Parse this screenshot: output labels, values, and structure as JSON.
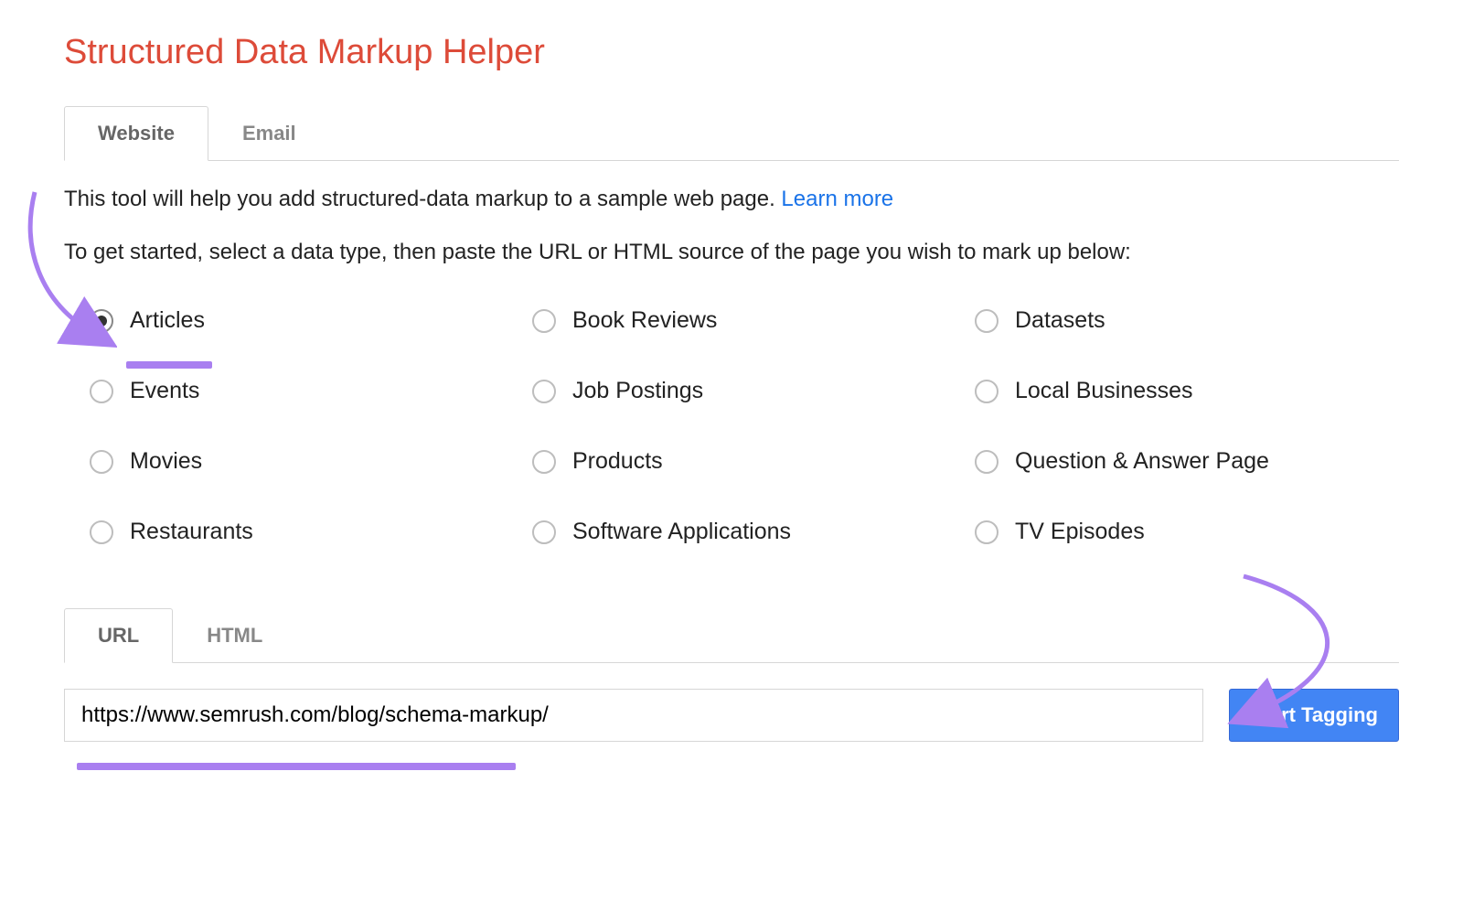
{
  "header": {
    "title": "Structured Data Markup Helper"
  },
  "main_tabs": {
    "items": [
      {
        "label": "Website",
        "active": true
      },
      {
        "label": "Email",
        "active": false
      }
    ]
  },
  "intro": {
    "text_before_link": "This tool will help you add structured-data markup to a sample web page. ",
    "link_text": "Learn more",
    "subline": "To get started, select a data type, then paste the URL or HTML source of the page you wish to mark up below:"
  },
  "data_types": {
    "options": [
      {
        "id": "articles",
        "label": "Articles",
        "selected": true
      },
      {
        "id": "book-reviews",
        "label": "Book Reviews",
        "selected": false
      },
      {
        "id": "datasets",
        "label": "Datasets",
        "selected": false
      },
      {
        "id": "events",
        "label": "Events",
        "selected": false
      },
      {
        "id": "job-postings",
        "label": "Job Postings",
        "selected": false
      },
      {
        "id": "local-businesses",
        "label": "Local Businesses",
        "selected": false
      },
      {
        "id": "movies",
        "label": "Movies",
        "selected": false
      },
      {
        "id": "products",
        "label": "Products",
        "selected": false
      },
      {
        "id": "qa-page",
        "label": "Question & Answer Page",
        "selected": false
      },
      {
        "id": "restaurants",
        "label": "Restaurants",
        "selected": false
      },
      {
        "id": "software-apps",
        "label": "Software Applications",
        "selected": false
      },
      {
        "id": "tv-episodes",
        "label": "TV Episodes",
        "selected": false
      }
    ]
  },
  "source_tabs": {
    "items": [
      {
        "label": "URL",
        "active": true
      },
      {
        "label": "HTML",
        "active": false
      }
    ]
  },
  "url_input": {
    "value": "https://www.semrush.com/blog/schema-markup/",
    "placeholder": ""
  },
  "actions": {
    "start_tagging_label": "Start Tagging"
  },
  "annotations": {
    "colors": {
      "highlight": "#a97ff0"
    },
    "arrows": [
      {
        "name": "arrow-to-articles"
      },
      {
        "name": "arrow-to-start-tagging"
      }
    ],
    "underlines": [
      {
        "name": "underline-articles"
      },
      {
        "name": "underline-url"
      }
    ]
  }
}
